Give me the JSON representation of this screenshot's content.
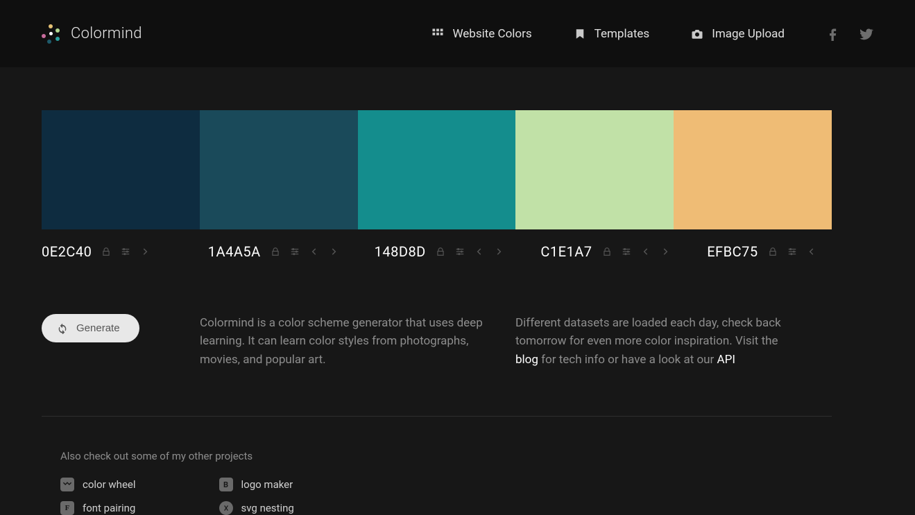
{
  "brand": {
    "name": "Colormind"
  },
  "nav": {
    "website_colors": "Website Colors",
    "templates": "Templates",
    "image_upload": "Image Upload"
  },
  "palette": [
    {
      "hex": "0E2C40",
      "color": "#0E2C40",
      "has_prev": false,
      "has_next": true
    },
    {
      "hex": "1A4A5A",
      "color": "#1A4A5A",
      "has_prev": true,
      "has_next": true
    },
    {
      "hex": "148D8D",
      "color": "#148D8D",
      "has_prev": true,
      "has_next": true
    },
    {
      "hex": "C1E1A7",
      "color": "#C1E1A7",
      "has_prev": true,
      "has_next": true
    },
    {
      "hex": "EFBC75",
      "color": "#EFBC75",
      "has_prev": true,
      "has_next": false
    }
  ],
  "generate_label": "Generate",
  "description": {
    "left": "Colormind is a color scheme generator that uses deep learning. It can learn color styles from photographs, movies, and popular art.",
    "right_1": "Different datasets are loaded each day, check back tomorrow for even more color inspiration. Visit the ",
    "right_link1": "blog",
    "right_2": " for tech info or have a look at our ",
    "right_link2": "API"
  },
  "footer": {
    "heading": "Also check out some of my other projects",
    "color_wheel": "color wheel",
    "font_pairing": "font pairing",
    "logo_maker": "logo maker",
    "svg_nesting": "svg nesting"
  }
}
